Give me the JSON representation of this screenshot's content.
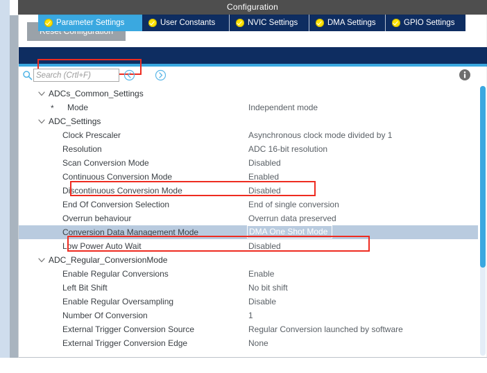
{
  "window": {
    "title": "Configuration"
  },
  "toolbar": {
    "reset_label": "Reset Configuration"
  },
  "tabs": [
    {
      "label": "Parameter Settings",
      "icon": "check-circle-icon",
      "active": true
    },
    {
      "label": "User Constants",
      "icon": "check-circle-icon",
      "active": false
    },
    {
      "label": "NVIC Settings",
      "icon": "check-circle-icon",
      "active": false
    },
    {
      "label": "DMA Settings",
      "icon": "check-circle-icon",
      "active": false
    },
    {
      "label": "GPIO Settings",
      "icon": "check-circle-icon",
      "active": false
    }
  ],
  "search": {
    "value": "",
    "placeholder": "Search (Crtl+F)",
    "icon": "search-icon",
    "prev_icon": "chevron-left-circle-icon",
    "next_icon": "chevron-right-circle-icon"
  },
  "info": {
    "icon": "info-icon"
  },
  "tree": [
    {
      "type": "group",
      "label": "ADCs_Common_Settings",
      "value": "",
      "expanded": true
    },
    {
      "type": "item",
      "label": "Mode",
      "value": "Independent mode",
      "starred": true
    },
    {
      "type": "group",
      "label": "ADC_Settings",
      "value": "",
      "expanded": true
    },
    {
      "type": "item",
      "label": "Clock Prescaler",
      "value": "Asynchronous clock mode divided by 1"
    },
    {
      "type": "item",
      "label": "Resolution",
      "value": "ADC 16-bit resolution"
    },
    {
      "type": "item",
      "label": "Scan Conversion Mode",
      "value": "Disabled"
    },
    {
      "type": "item",
      "label": "Continuous Conversion Mode",
      "value": "Enabled",
      "annotated": true
    },
    {
      "type": "item",
      "label": "Discontinuous Conversion Mode",
      "value": "Disabled"
    },
    {
      "type": "item",
      "label": "End Of Conversion Selection",
      "value": "End of single conversion"
    },
    {
      "type": "item",
      "label": "Overrun behaviour",
      "value": "Overrun data preserved"
    },
    {
      "type": "item",
      "label": "Conversion Data Management Mode",
      "value": "DMA One Shot Mode",
      "selected": true,
      "annotated": true
    },
    {
      "type": "item",
      "label": "Low Power Auto Wait",
      "value": "Disabled"
    },
    {
      "type": "group",
      "label": "ADC_Regular_ConversionMode",
      "value": "",
      "expanded": true
    },
    {
      "type": "item",
      "label": "Enable Regular Conversions",
      "value": "Enable"
    },
    {
      "type": "item",
      "label": "Left Bit Shift",
      "value": "No bit shift"
    },
    {
      "type": "item",
      "label": "Enable Regular Oversampling",
      "value": "Disable"
    },
    {
      "type": "item",
      "label": "Number Of Conversion",
      "value": "1"
    },
    {
      "type": "item",
      "label": "External Trigger Conversion Source",
      "value": "Regular Conversion launched by software"
    },
    {
      "type": "item",
      "label": "External Trigger Conversion Edge",
      "value": "None"
    }
  ],
  "star_glyph": "*",
  "colors": {
    "titlebar_bg": "#4e4e4e",
    "tabbar_bg": "#0e2d61",
    "tab_active_bg": "#3aa8e0",
    "annotation_red": "#ee2b20",
    "selection_bg": "#b9cbdf",
    "scrollbar_thumb": "#3aa8e0",
    "check_icon": "#ffe300"
  }
}
